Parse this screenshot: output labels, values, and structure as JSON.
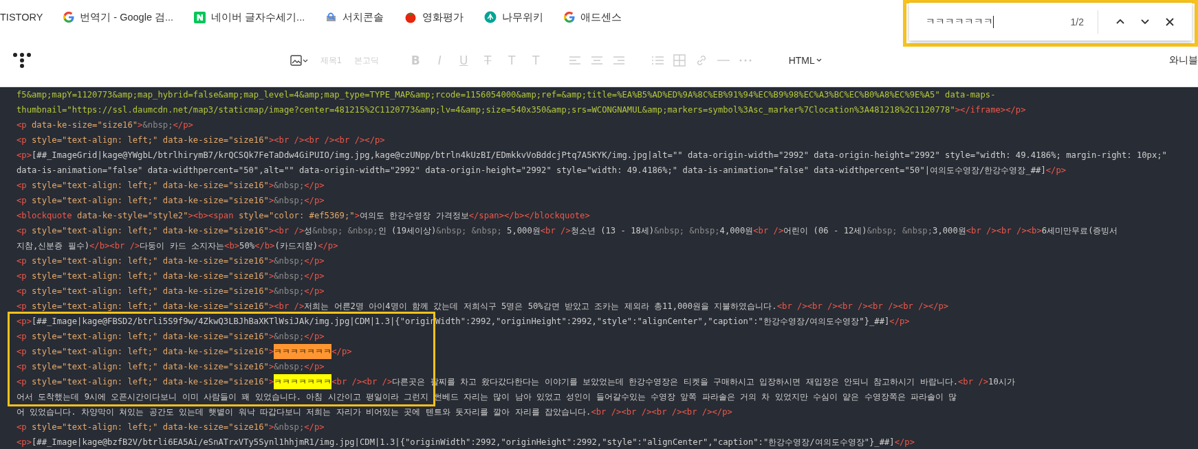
{
  "bookmarks_bar": {
    "items": [
      {
        "kind": "none",
        "label": "TISTORY"
      },
      {
        "kind": "google",
        "label": "번역기 - Google 검..."
      },
      {
        "kind": "naver",
        "label": "네이버 글자수세기..."
      },
      {
        "kind": "console",
        "label": "서치콘솔"
      },
      {
        "kind": "tomato",
        "label": "영화평가"
      },
      {
        "kind": "wiki",
        "label": "나무위키"
      },
      {
        "kind": "google",
        "label": "애드센스"
      }
    ]
  },
  "find_bar": {
    "query": "ㅋㅋㅋㅋㅋㅋㅋ",
    "count": "1/2"
  },
  "toolbar": {
    "heading_dropdown": "제목1",
    "font_dropdown": "본고딕",
    "format_buttons": [
      "B",
      "I",
      "U",
      "T",
      "T",
      "T"
    ],
    "formatting_disabled": true,
    "mode_dropdown": "HTML",
    "user": "와니블"
  },
  "code_lines": [
    [
      {
        "kind": "str",
        "text": "f5&amp;mapY=1120773&amp;map_hybrid=false&amp;map_level=4&amp;map_type=TYPE_MAP&amp;rcode=1156054000&amp;ref=&amp;title=%EA%B5%AD%ED%9A%8C%EB%91%94%EC%B9%98%EC%A3%BC%EC%B0%A8%EC%9E%A5\" data-maps-"
      }
    ],
    [
      {
        "kind": "str",
        "text": "thumbnail=\"https://ssl.daumcdn.net/map3/staticmap/image?center=481215%2C1120773&amp;lv=4&amp;size=540x350&amp;srs=WCONGNAMUL&amp;markers=symbol%3Asc_marker%7Clocation%3A481218%2C1120778\""
      },
      {
        "kind": "tag",
        "text": "></iframe></p>"
      }
    ],
    [
      {
        "kind": "tag",
        "text": "<p "
      },
      {
        "kind": "attr",
        "text": "data-ke-size=\"size16\""
      },
      {
        "kind": "tag",
        "text": ">"
      },
      {
        "kind": "ent",
        "text": "&nbsp;"
      },
      {
        "kind": "tag",
        "text": "</p>"
      }
    ],
    [
      {
        "kind": "tag",
        "text": "<p "
      },
      {
        "kind": "attr",
        "text": "style=\"text-align: left;\" data-ke-size=\"size16\""
      },
      {
        "kind": "tag",
        "text": "><br /><br /><br /></p>"
      }
    ],
    [
      {
        "kind": "tag",
        "text": "<p>"
      },
      {
        "kind": "text",
        "text": "[##_ImageGrid|kage@YWgbL/btrlhirymB7/krQCSQk7FeTaDdw4GiPUIO/img.jpg,kage@czUNpp/btrln4kUzBI/EDmkkvVoBddcjPtq7A5KYK/img.jpg|alt=\"\" data-origin-width=\"2992\" data-origin-height=\"2992\" style=\"width: 49.4186%; margin-right: 10px;\""
      }
    ],
    [
      {
        "kind": "text",
        "text": "data-is-animation=\"false\" data-widthpercent=\"50\",alt=\"\" data-origin-width=\"2992\" data-origin-height=\"2992\" style=\"width: 49.4186%;\" data-is-animation=\"false\" data-widthpercent=\"50\"|여의도수영장/한강수영장_##]"
      },
      {
        "kind": "tag",
        "text": "</p>"
      }
    ],
    [
      {
        "kind": "tag",
        "text": "<p "
      },
      {
        "kind": "attr",
        "text": "style=\"text-align: left;\" data-ke-size=\"size16\""
      },
      {
        "kind": "tag",
        "text": ">"
      },
      {
        "kind": "ent",
        "text": "&nbsp;"
      },
      {
        "kind": "tag",
        "text": "</p>"
      }
    ],
    [
      {
        "kind": "tag",
        "text": "<p "
      },
      {
        "kind": "attr",
        "text": "style=\"text-align: left;\" data-ke-size=\"size16\""
      },
      {
        "kind": "tag",
        "text": ">"
      },
      {
        "kind": "ent",
        "text": "&nbsp;"
      },
      {
        "kind": "tag",
        "text": "</p>"
      }
    ],
    [
      {
        "kind": "tag",
        "text": "<blockquote "
      },
      {
        "kind": "attr",
        "text": "data-ke-style=\"style2\""
      },
      {
        "kind": "tag",
        "text": "><b><span "
      },
      {
        "kind": "attr",
        "text": "style=\"color: #ef5369;\""
      },
      {
        "kind": "tag",
        "text": ">"
      },
      {
        "kind": "text",
        "text": "여의도 한강수영장 가격정보"
      },
      {
        "kind": "tag",
        "text": "</span></b></blockquote>"
      }
    ],
    [
      {
        "kind": "tag",
        "text": "<p "
      },
      {
        "kind": "attr",
        "text": "style=\"text-align: left;\" data-ke-size=\"size16\""
      },
      {
        "kind": "tag",
        "text": "><br />"
      },
      {
        "kind": "text",
        "text": "성"
      },
      {
        "kind": "ent",
        "text": "&nbsp; &nbsp;"
      },
      {
        "kind": "text",
        "text": "인 (19세이상)"
      },
      {
        "kind": "ent",
        "text": "&nbsp; &nbsp;"
      },
      {
        "kind": "text",
        "text": " 5,000원"
      },
      {
        "kind": "tag",
        "text": "<br />"
      },
      {
        "kind": "text",
        "text": "청소년 (13 - 18세)"
      },
      {
        "kind": "ent",
        "text": "&nbsp; &nbsp;"
      },
      {
        "kind": "text",
        "text": "4,000원"
      },
      {
        "kind": "tag",
        "text": "<br />"
      },
      {
        "kind": "text",
        "text": "어린이 (06 - 12세)"
      },
      {
        "kind": "ent",
        "text": "&nbsp; &nbsp;"
      },
      {
        "kind": "text",
        "text": "3,000원"
      },
      {
        "kind": "tag",
        "text": "<br /><br /><b>"
      },
      {
        "kind": "text",
        "text": "6세미만무료(증빙서"
      }
    ],
    [
      {
        "kind": "text",
        "text": "지참,신분증 필수)"
      },
      {
        "kind": "tag",
        "text": "</b><br />"
      },
      {
        "kind": "text",
        "text": "다둥이 카드 소지자는"
      },
      {
        "kind": "tag",
        "text": "<b>"
      },
      {
        "kind": "text",
        "text": "50%"
      },
      {
        "kind": "tag",
        "text": "</b>"
      },
      {
        "kind": "text",
        "text": "(카드지참)"
      },
      {
        "kind": "tag",
        "text": "</p>"
      }
    ],
    [
      {
        "kind": "tag",
        "text": "<p "
      },
      {
        "kind": "attr",
        "text": "style=\"text-align: left;\" data-ke-size=\"size16\""
      },
      {
        "kind": "tag",
        "text": ">"
      },
      {
        "kind": "ent",
        "text": "&nbsp;"
      },
      {
        "kind": "tag",
        "text": "</p>"
      }
    ],
    [
      {
        "kind": "tag",
        "text": "<p "
      },
      {
        "kind": "attr",
        "text": "style=\"text-align: left;\" data-ke-size=\"size16\""
      },
      {
        "kind": "tag",
        "text": ">"
      },
      {
        "kind": "ent",
        "text": "&nbsp;"
      },
      {
        "kind": "tag",
        "text": "</p>"
      }
    ],
    [
      {
        "kind": "tag",
        "text": "<p "
      },
      {
        "kind": "attr",
        "text": "style=\"text-align: left;\" data-ke-size=\"size16\""
      },
      {
        "kind": "tag",
        "text": ">"
      },
      {
        "kind": "ent",
        "text": "&nbsp;"
      },
      {
        "kind": "tag",
        "text": "</p>"
      }
    ],
    [
      {
        "kind": "tag",
        "text": "<p "
      },
      {
        "kind": "attr",
        "text": "style=\"text-align: left;\" data-ke-size=\"size16\""
      },
      {
        "kind": "tag",
        "text": "><br />"
      },
      {
        "kind": "text",
        "text": "저희는 어른2명 아이4명이 함께 갔는데 저희식구 5명은 50%감면 받았고 조카는 제외라 총11,000원을 지불하였습니다."
      },
      {
        "kind": "tag",
        "text": "<br /><br /><br /><br /><br /></p>"
      }
    ],
    [
      {
        "kind": "tag",
        "text": "<p>"
      },
      {
        "kind": "text",
        "text": "[##_Image|kage@FBSD2/btrli5S9f9w/4ZkwQ3LBJhBaXKTlWsiJAk/img.jpg|CDM|1.3|{\"originWidth\":2992,\"originHeight\":2992,\"style\":\"alignCenter\",\"caption\":\"한강수영장/여의도수영장\"}_##]"
      },
      {
        "kind": "tag",
        "text": "</p>"
      }
    ],
    [
      {
        "kind": "tag",
        "text": "<p "
      },
      {
        "kind": "attr",
        "text": "style=\"text-align: left;\" data-ke-size=\"size16\""
      },
      {
        "kind": "tag",
        "text": ">"
      },
      {
        "kind": "ent",
        "text": "&nbsp;"
      },
      {
        "kind": "tag",
        "text": "</p>"
      }
    ],
    [
      {
        "kind": "tag",
        "text": "<p "
      },
      {
        "kind": "attr",
        "text": "style=\"text-align: left;\" data-ke-size=\"size16\""
      },
      {
        "kind": "tag",
        "text": ">"
      },
      {
        "kind": "match",
        "text": "ㅋㅋㅋㅋㅋㅋㅋ",
        "current": true
      },
      {
        "kind": "tag",
        "text": "</p>"
      }
    ],
    [
      {
        "kind": "tag",
        "text": "<p "
      },
      {
        "kind": "attr",
        "text": "style=\"text-align: left;\" data-ke-size=\"size16\""
      },
      {
        "kind": "tag",
        "text": ">"
      },
      {
        "kind": "ent",
        "text": "&nbsp;"
      },
      {
        "kind": "tag",
        "text": "</p>"
      }
    ],
    [
      {
        "kind": "tag",
        "text": "<p "
      },
      {
        "kind": "attr",
        "text": "style=\"text-align: left;\" data-ke-size=\"size16\""
      },
      {
        "kind": "tag",
        "text": ">"
      },
      {
        "kind": "match",
        "text": "ㅋㅋㅋㅋㅋㅋㅋ",
        "current": false
      },
      {
        "kind": "tag",
        "text": "<br /><br />"
      },
      {
        "kind": "text",
        "text": "다른곳은 팔찌를 차고 왔다갔다한다는 이야기를 보았었는데 한강수영장은 티켓을 구매하시고 입장하시면 재입장은 안되니 참고하시기 바랍니다."
      },
      {
        "kind": "tag",
        "text": "<br />"
      },
      {
        "kind": "text",
        "text": "10시가"
      }
    ],
    [
      {
        "kind": "text",
        "text": "어서 도착했는데 9시에 오픈시간이다보니 이미 사람들이 꽤 있었습니다. 아침 시간이고 평일이라 그런지 썬베드 자리는 많이 남아 있었고 성인이 들어갈수있는 수영장 앞쪽 파라솔은 거의 차 있었지만 수심이 얕은 수영장쪽은 파라솔이 많"
      }
    ],
    [
      {
        "kind": "text",
        "text": "어 있었습니다. 차양막이 쳐있는 공간도 있는데 햇볕이 워낙 따갑다보니 저희는 자리가 비어있는 곳에 텐트와 돗자리를 깔아 자리를 잡았습니다."
      },
      {
        "kind": "tag",
        "text": "<br /><br /><br /><br /></p>"
      }
    ],
    [
      {
        "kind": "tag",
        "text": "<p "
      },
      {
        "kind": "attr",
        "text": "style=\"text-align: left;\" data-ke-size=\"size16\""
      },
      {
        "kind": "tag",
        "text": ">"
      },
      {
        "kind": "ent",
        "text": "&nbsp;"
      },
      {
        "kind": "tag",
        "text": "</p>"
      }
    ],
    [
      {
        "kind": "tag",
        "text": "<p>"
      },
      {
        "kind": "text",
        "text": "[##_Image|kage@bzfB2V/btrli6EA5Ai/eSnATrxVTy5Synl1hhjmR1/img.jpg|CDM|1.3|{\"originWidth\":2992,\"originHeight\":2992,\"style\":\"alignCenter\",\"caption\":\"한강수영장/여의도수영장\"}_##]"
      },
      {
        "kind": "tag",
        "text": "</p>"
      }
    ]
  ]
}
